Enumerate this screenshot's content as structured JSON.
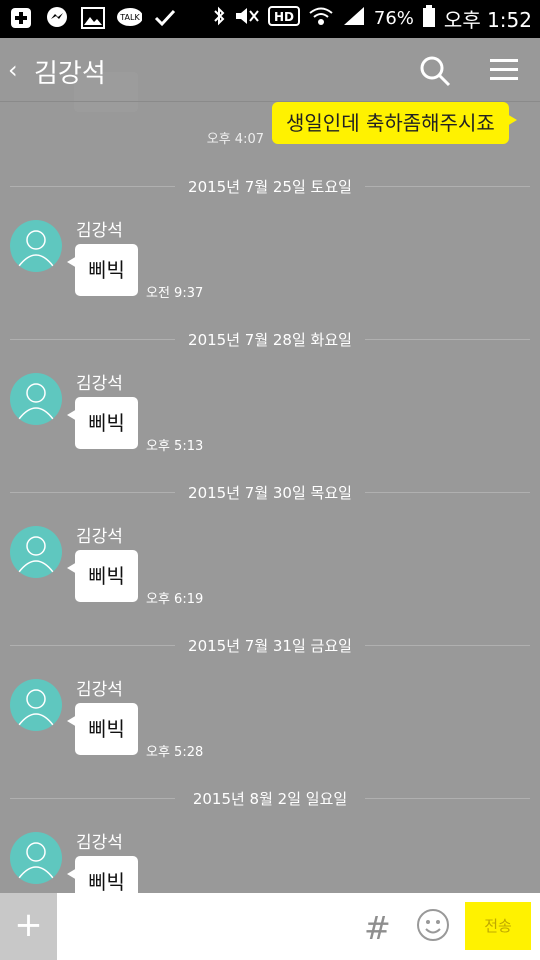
{
  "status_bar": {
    "battery": "76%",
    "time": "오후 1:52"
  },
  "header": {
    "back_symbol": "‹",
    "title": "김강석"
  },
  "my_message": {
    "text": "생일인데 축하좀해주시죠",
    "time": "오후 4:07"
  },
  "dates": [
    "2015년 7월 25일 토요일",
    "2015년 7월 28일 화요일",
    "2015년 7월 30일 목요일",
    "2015년 7월 31일 금요일",
    "2015년 8월 2일 일요일"
  ],
  "messages": [
    {
      "sender": "김강석",
      "text": "삐빅",
      "time": "오전 9:37"
    },
    {
      "sender": "김강석",
      "text": "삐빅",
      "time": "오후 5:13"
    },
    {
      "sender": "김강석",
      "text": "삐빅",
      "time": "오후 6:19"
    },
    {
      "sender": "김강석",
      "text": "삐빅",
      "time": "오후 5:28"
    },
    {
      "sender": "김강석",
      "text": "삐빅",
      "time": ""
    }
  ],
  "input_bar": {
    "plus_label": "+",
    "hash_label": "#",
    "send_label": "전송",
    "placeholder": ""
  },
  "colors": {
    "background": "#999999",
    "accent_yellow": "#FFF200",
    "avatar_teal": "#5fc7bf"
  }
}
